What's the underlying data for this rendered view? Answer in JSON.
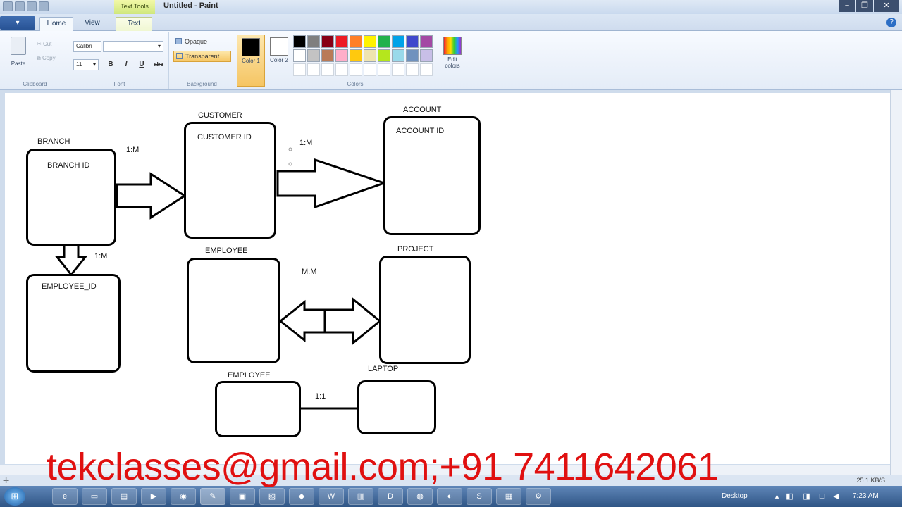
{
  "window": {
    "title": "Untitled - Paint",
    "contextual_tab": "Text Tools",
    "controls": [
      "–",
      "❐",
      "✕"
    ]
  },
  "ribbon_tabs": {
    "home": "Home",
    "view": "View",
    "text": "Text"
  },
  "clipboard": {
    "paste": "Paste",
    "cut": "Cut",
    "copy": "Copy",
    "group": "Clipboard"
  },
  "font": {
    "family": "Calibri",
    "size": "11",
    "bold": "B",
    "italic": "I",
    "underline": "U",
    "strike": "abc",
    "group": "Font"
  },
  "background": {
    "opaque": "Opaque",
    "transparent": "Transparent",
    "group": "Background"
  },
  "colors": {
    "color1_label": "Color 1",
    "color2_label": "Color 2",
    "edit_label": "Edit colors",
    "group": "Colors",
    "color1": "#000000",
    "color2": "#ffffff",
    "palette": [
      "#000000",
      "#7f7f7f",
      "#880015",
      "#ed1c24",
      "#ff7f27",
      "#fff200",
      "#22b14c",
      "#00a2e8",
      "#3f48cc",
      "#a349a4",
      "#ffffff",
      "#c3c3c3",
      "#b97a57",
      "#ffaec9",
      "#ffc90e",
      "#efe4b0",
      "#b5e61d",
      "#99d9ea",
      "#7092be",
      "#c8bfe7",
      "#ffffff",
      "#ffffff",
      "#ffffff",
      "#ffffff",
      "#ffffff",
      "#ffffff",
      "#ffffff",
      "#ffffff",
      "#ffffff",
      "#ffffff"
    ]
  },
  "diagram": {
    "branch_title": "BRANCH",
    "branch_attr": "BRANCH ID",
    "customer_title": "CUSTOMER",
    "customer_attr": "CUSTOMER ID",
    "account_title": "ACCOUNT",
    "account_attr": "ACCOUNT ID",
    "employee_attr_box": "EMPLOYEE_ID",
    "employee_title": "EMPLOYEE",
    "project_title": "PROJECT",
    "employee2_title": "EMPLOYEE",
    "laptop_title": "LAPTOP",
    "rel_branch_customer": "1:M",
    "rel_customer_account": "1:M",
    "rel_branch_employee": "1:M",
    "rel_employee_project": "M:M",
    "rel_employee_laptop": "1:1"
  },
  "status": {
    "speed": "25.1 KB/S"
  },
  "taskbar": {
    "start": "⊞",
    "desktop": "Desktop",
    "time": "7:23 AM"
  },
  "watermark": "tekclasses@gmail.com;+91 7411642061"
}
